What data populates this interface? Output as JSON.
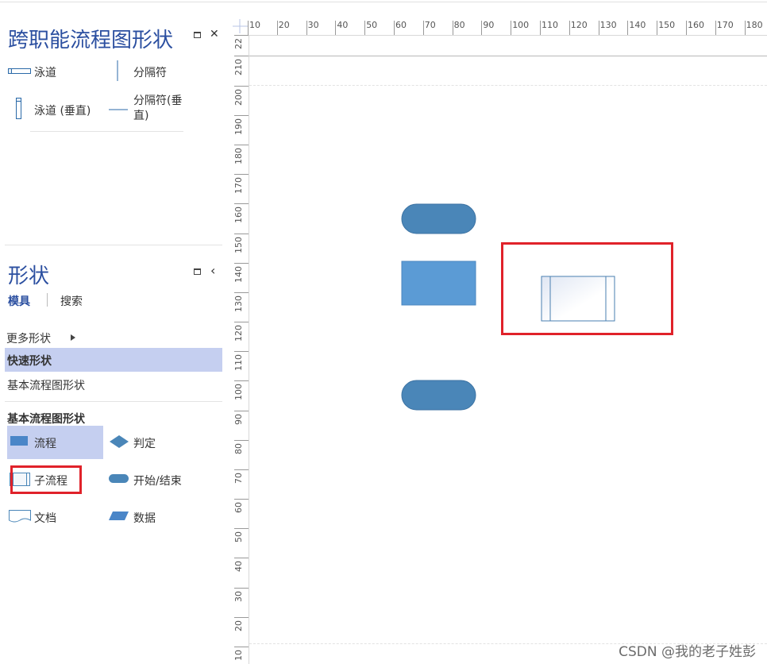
{
  "top_panel": {
    "title": "跨职能流程图形状",
    "items": [
      {
        "label": "泳道",
        "icon": "swimlane-icon"
      },
      {
        "label": "分隔符",
        "icon": "separator-icon"
      },
      {
        "label": "泳道 (垂直)",
        "icon": "swimlane-vertical-icon"
      },
      {
        "label": "分隔符(垂直)",
        "icon": "separator-vertical-icon"
      }
    ],
    "restore_icon": "restore-icon",
    "close_glyph": "✕"
  },
  "shapes_panel": {
    "title": "形状",
    "collapse_glyph": "‹",
    "tabs": [
      {
        "label": "模具",
        "active": true
      },
      {
        "label": "搜索",
        "active": false
      }
    ],
    "more_shapes": "更多形状",
    "stencils": [
      {
        "label": "快速形状",
        "selected": true
      },
      {
        "label": "基本流程图形状",
        "selected": false
      }
    ],
    "section_title": "基本流程图形状",
    "shapes": [
      {
        "label": "流程",
        "icon": "process-icon",
        "selected": true
      },
      {
        "label": "判定",
        "icon": "decision-icon"
      },
      {
        "label": "子流程",
        "icon": "subprocess-icon"
      },
      {
        "label": "开始/结束",
        "icon": "start-end-icon"
      },
      {
        "label": "文档",
        "icon": "document-icon"
      },
      {
        "label": "数据",
        "icon": "data-icon"
      }
    ]
  },
  "ruler": {
    "horizontal": [
      "10",
      "20",
      "30",
      "40",
      "50",
      "60",
      "70",
      "80",
      "90",
      "100",
      "110",
      "120",
      "130",
      "140",
      "150",
      "160",
      "170",
      "180"
    ],
    "vertical": [
      "22",
      "210",
      "200",
      "190",
      "180",
      "170",
      "160",
      "150",
      "140",
      "130",
      "120",
      "110",
      "100",
      "90",
      "80",
      "70",
      "60",
      "50",
      "40",
      "30",
      "20",
      "10"
    ]
  },
  "colors": {
    "accent": "#2b4fa0",
    "terminator": "#4a86b8",
    "process": "#5b9bd5",
    "highlight_red": "#e0222a",
    "selected_bg": "#c5cff0"
  },
  "watermark": "CSDN @我的老子姓彭"
}
